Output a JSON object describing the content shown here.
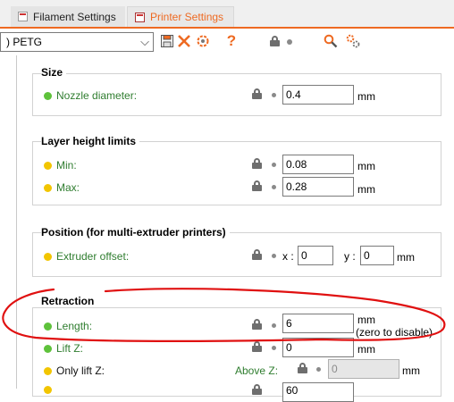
{
  "tabs": [
    {
      "label": "Filament Settings"
    },
    {
      "label": "Printer Settings"
    }
  ],
  "toolbar": {
    "preset_value": ") PETG",
    "help_label": "?"
  },
  "sections": {
    "size": {
      "title": "Size",
      "nozzle_label": "Nozzle diameter:",
      "nozzle_value": "0.4",
      "unit": "mm"
    },
    "layer": {
      "title": "Layer height limits",
      "min_label": "Min:",
      "min_value": "0.08",
      "max_label": "Max:",
      "max_value": "0.28",
      "unit": "mm"
    },
    "position": {
      "title": "Position (for multi-extruder printers)",
      "offset_label": "Extruder offset:",
      "x_label": "x :",
      "x_value": "0",
      "y_label": "y :",
      "y_value": "0",
      "unit": "mm"
    },
    "retraction": {
      "title": "Retraction",
      "length_label": "Length:",
      "length_value": "6",
      "length_unit": "mm",
      "length_note": "(zero to disable)",
      "liftz_label": "Lift Z:",
      "liftz_value": "0",
      "liftz_unit": "mm",
      "onlylift_label": "Only lift Z:",
      "above_label": "Above Z:",
      "above_value": "0",
      "above_unit": "mm",
      "next_value": "60"
    }
  },
  "colors": {
    "accent": "#ee6a22",
    "advanced_green": "#5ec23b",
    "expert_yellow": "#f2c500",
    "annotation_red": "#e01010"
  },
  "icons": [
    "save-icon",
    "delete-icon",
    "compare-icon",
    "help-icon",
    "lock-icon",
    "search-icon",
    "settings-icon"
  ]
}
